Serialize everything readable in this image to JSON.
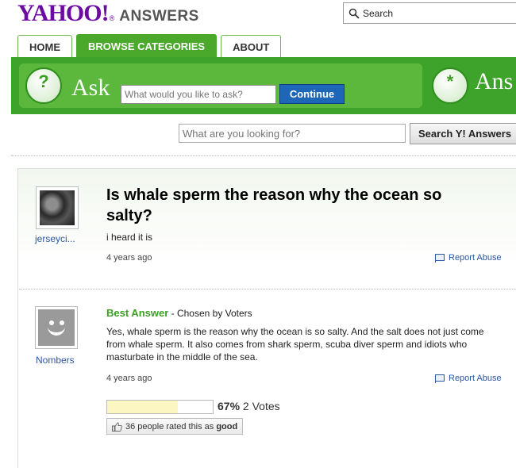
{
  "header": {
    "logo_text": "YAHOO!",
    "logo_reg": "®",
    "product": "ANSWERS",
    "top_search_label": "Search"
  },
  "tabs": [
    {
      "label": "HOME",
      "active": false
    },
    {
      "label": "BROWSE CATEGORIES",
      "active": true
    },
    {
      "label": "ABOUT",
      "active": false
    }
  ],
  "askbar": {
    "ask_label": "Ask",
    "ask_placeholder": "What would you like to ask?",
    "continue_label": "Continue",
    "answer_label": "Ans",
    "left_icon_glyph": "?",
    "right_icon_glyph": "*"
  },
  "search": {
    "placeholder": "What are you looking for?",
    "button_label": "Search Y! Answers"
  },
  "question": {
    "username": "jerseyci...",
    "title": "Is whale sperm the reason why the ocean so salty?",
    "detail": "i heard it is",
    "time": "4 years ago",
    "report_label": "Report Abuse"
  },
  "answer": {
    "username": "Nombers",
    "best_label": "Best Answer",
    "chosen_by": " - Chosen by Voters",
    "text": "Yes, whale sperm is the reason why the ocean is so salty. And the salt does not just come from whale sperm. It also comes from shark sperm, scuba diver sperm and idiots who masturbate in the middle of the sea.",
    "time": "4 years ago",
    "report_label": "Report Abuse",
    "rating_fraction": 0.67,
    "rating_percent": "67%",
    "votes": "2 Votes",
    "rated_text": "36 people rated this as",
    "rated_word": "good"
  },
  "colors": {
    "brand_purple": "#6b0ba2",
    "green": "#3ea32a",
    "link_blue": "#2b57a3",
    "continue_blue": "#1d66b8"
  }
}
